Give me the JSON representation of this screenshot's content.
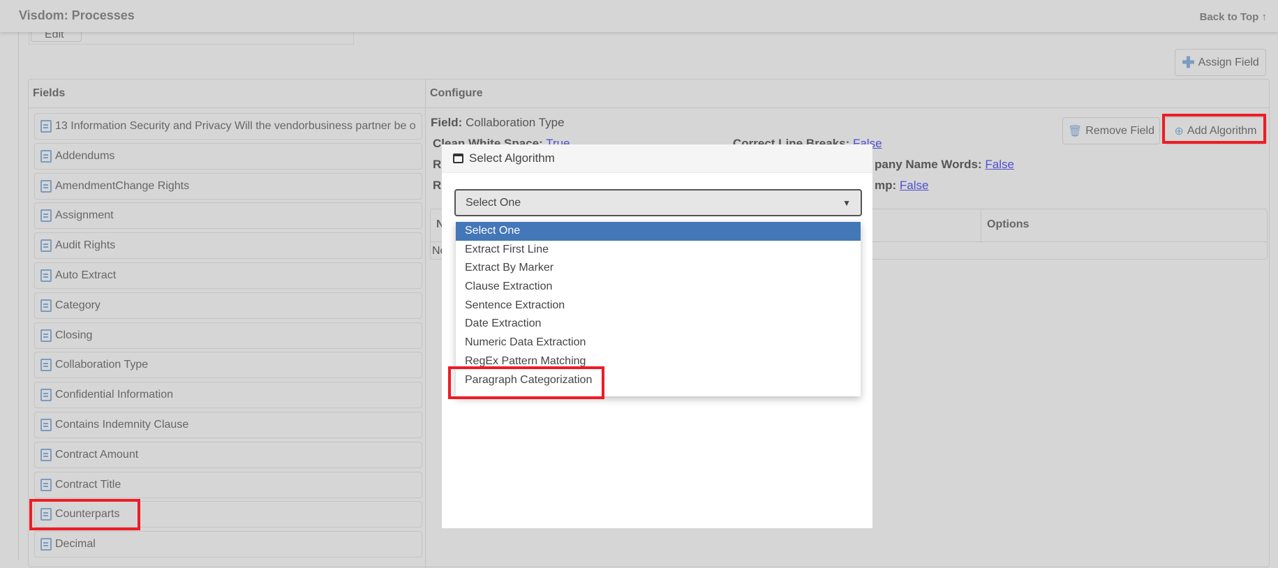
{
  "header": {
    "title": "Visdom: Processes",
    "back_to_top": "Back to Top ↑"
  },
  "toolbar": {
    "edit_label": "Edit",
    "assign_field": "Assign Field"
  },
  "fields_panel": {
    "title": "Fields",
    "items": [
      "13 Information Security and Privacy Will the vendorbusiness partner be o",
      "Addendums",
      "AmendmentChange Rights",
      "Assignment",
      "Audit Rights",
      "Auto Extract",
      "Category",
      "Closing",
      "Collaboration Type",
      "Confidential Information",
      "Contains Indemnity Clause",
      "Contract Amount",
      "Contract Title",
      "Counterparts",
      "Decimal"
    ]
  },
  "configure": {
    "title": "Configure",
    "field_label": "Field:",
    "field_value": "Collaboration Type",
    "remove_field": "Remove Field",
    "add_algorithm": "Add Algorithm",
    "settings": [
      {
        "label": "Clean White Space:",
        "value": "True"
      },
      {
        "label": "Correct Line Breaks:",
        "value": "False"
      },
      {
        "label": "R",
        "value": ""
      },
      {
        "label": "pany Name Words:",
        "value": "False"
      },
      {
        "label": "R",
        "value": ""
      },
      {
        "label": "mp:",
        "value": "False"
      }
    ],
    "table": {
      "col1": "N",
      "col_options": "Options",
      "row1": "No"
    }
  },
  "modal": {
    "title": "Select Algorithm",
    "select_value": "Select One",
    "options": [
      "Select One",
      "Extract First Line",
      "Extract By Marker",
      "Clause Extraction",
      "Sentence Extraction",
      "Date Extraction",
      "Numeric Data Extraction",
      "RegEx Pattern Matching",
      "Paragraph Categorization"
    ],
    "selected_index": 0
  },
  "colors": {
    "highlight": "#4477b8",
    "annotation": "#ee1c24",
    "link": "#4f4fd0"
  }
}
